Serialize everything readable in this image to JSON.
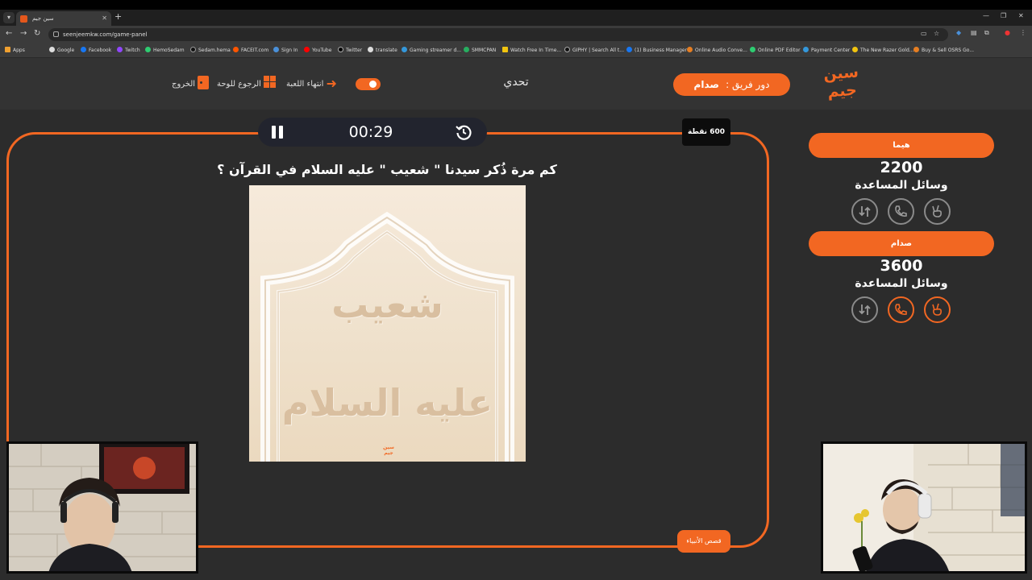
{
  "browser": {
    "tab_title": "سين جيم",
    "url": "seenjeemkw.com/game-panel",
    "bookmarks": [
      "Apps",
      "Google",
      "Facebook",
      "Twitch",
      "HemoSedam",
      "Sedam.hema",
      "FACEIT.com",
      "Sign In",
      "YouTube",
      "Twitter",
      "translate",
      "Gaming streamer d...",
      "SMMCPAN",
      "Watch Free In Time...",
      "GIPHY | Search All t...",
      "(1) Business Manager",
      "Online Audio Conve...",
      "Online PDF Editor",
      "Payment Center",
      "The New Razer Gold...",
      "Buy & Sell OSRS Go..."
    ]
  },
  "header": {
    "logo_line1": "سين",
    "logo_line2": "جيم",
    "turn_label": "دور فريق :",
    "turn_team": "صدام",
    "category": "تحدي",
    "end_game": "انتهاء اللعبة",
    "back_to_board": "الرجوع للوحة",
    "exit": "الخروج"
  },
  "question": {
    "timer": "00:29",
    "points": "600 نقطة",
    "text": "كم مرة ذُكر سيدنا \" شعيب \" عليه السلام في القرآن ؟",
    "image_text_line1": "شعيب",
    "image_text_line2": "عليه السلام",
    "image_logo_line1": "سين",
    "image_logo_line2": "جيم",
    "category_badge": "قصص الأنبياء"
  },
  "teams": [
    {
      "name": "هيما",
      "score": "2200",
      "aids_label": "وسائل المساعدة",
      "aids": [
        {
          "icon": "swap-icon",
          "active": false
        },
        {
          "icon": "phone-icon",
          "active": false
        },
        {
          "icon": "peace-hand-icon",
          "active": false
        }
      ]
    },
    {
      "name": "صدام",
      "score": "3600",
      "aids_label": "وسائل المساعدة",
      "aids": [
        {
          "icon": "swap-icon",
          "active": false
        },
        {
          "icon": "phone-icon",
          "active": true
        },
        {
          "icon": "peace-hand-icon",
          "active": true
        }
      ]
    }
  ],
  "colors": {
    "accent": "#f26722",
    "background": "#2c2c2c",
    "header_bg": "#333333",
    "timer_bg": "#22242e"
  }
}
